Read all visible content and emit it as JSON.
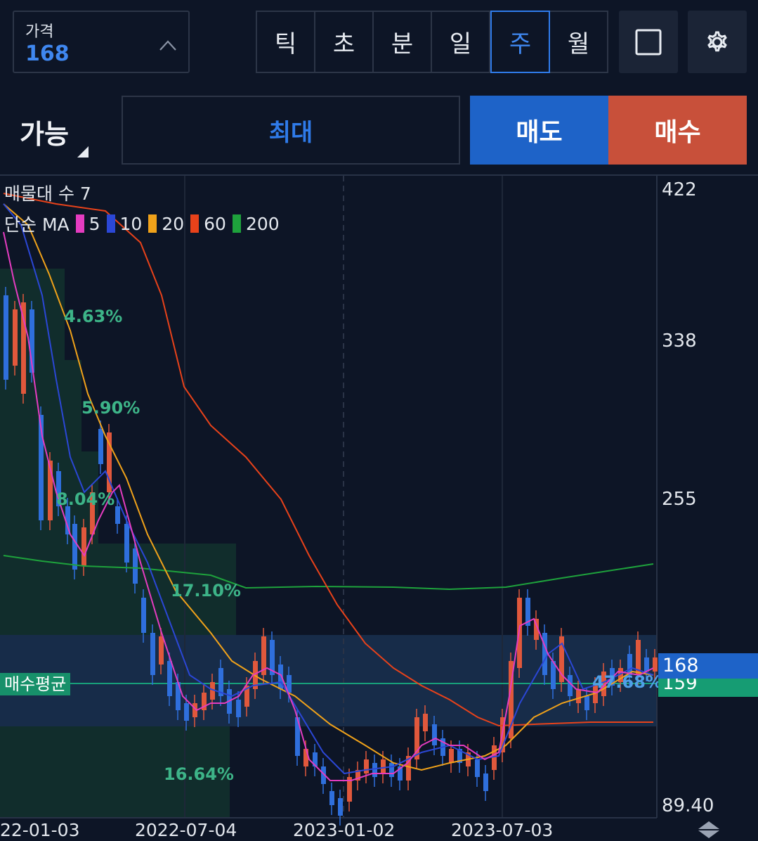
{
  "price": {
    "label": "가격",
    "value": "168"
  },
  "periods": [
    "틱",
    "초",
    "분",
    "일",
    "주",
    "월"
  ],
  "active_period": "주",
  "order": {
    "available": "가능",
    "max": "최대",
    "sell": "매도",
    "buy": "매수"
  },
  "legend": {
    "volume_profile": "매물대 수 7",
    "ma_title": "단순 MA",
    "ma": [
      {
        "period": "5",
        "color": "#e43cc0"
      },
      {
        "period": "10",
        "color": "#2b47d6"
      },
      {
        "period": "20",
        "color": "#f0a21a"
      },
      {
        "period": "60",
        "color": "#e8421a"
      },
      {
        "period": "200",
        "color": "#1ea23c"
      }
    ]
  },
  "volume_profile_labels": [
    "4.63%",
    "5.90%",
    "8.04%",
    "17.10%",
    "16.64%",
    "47.68%"
  ],
  "y_axis_labels": [
    "422",
    "338",
    "255",
    "89.40"
  ],
  "x_axis_labels": [
    "22-01-03",
    "2022-07-04",
    "2023-01-02",
    "2023-07-03"
  ],
  "current_price_tag": "168",
  "avg_price_tag": "159",
  "avg_price_label": "매수평균",
  "icons": [
    "chevron-up-icon",
    "square-icon",
    "gear-icon",
    "scroll-arrows-icon"
  ],
  "colors": {
    "up": "#e0583c",
    "down": "#2f6fdc",
    "accent": "#2f7bea"
  },
  "chart_data": {
    "type": "candlestick",
    "timeframe": "weekly",
    "ylim": [
      89.4,
      422
    ],
    "current_price": 168,
    "avg_buy_price": 159,
    "moving_averages": [
      "5",
      "10",
      "20",
      "60",
      "200"
    ],
    "volume_profile_pct": [
      "4.63%",
      "5.90%",
      "8.04%",
      "17.10%",
      "16.64%",
      "47.68%"
    ]
  }
}
